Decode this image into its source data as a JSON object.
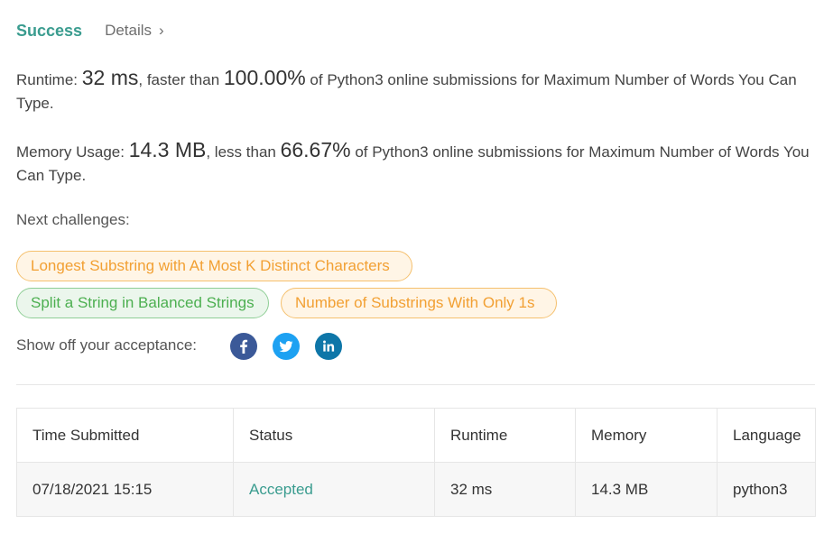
{
  "header": {
    "status": "Success",
    "details_label": "Details"
  },
  "runtime": {
    "label": "Runtime: ",
    "value": "32 ms",
    "middle": ", faster than ",
    "percent": "100.00%",
    "suffix": " of Python3 online submissions for Maximum Number of Words You Can Type."
  },
  "memory": {
    "label": "Memory Usage: ",
    "value": "14.3 MB",
    "middle": ", less than ",
    "percent": "66.67%",
    "suffix": " of Python3 online submissions for Maximum Number of Words You Can Type."
  },
  "next": {
    "label": "Next challenges:",
    "challenges": [
      {
        "title": "Longest Substring with At Most K Distinct Characters",
        "difficulty": "medium"
      },
      {
        "title": "Split a String in Balanced Strings",
        "difficulty": "easy"
      },
      {
        "title": "Number of Substrings With Only 1s",
        "difficulty": "medium"
      }
    ]
  },
  "share": {
    "label": "Show off your acceptance:",
    "icons": [
      "facebook-icon",
      "twitter-icon",
      "linkedin-icon"
    ],
    "colors": {
      "facebook": "#3b5998",
      "twitter": "#1da1f2",
      "linkedin": "#0e76a8"
    }
  },
  "table": {
    "headers": [
      "Time Submitted",
      "Status",
      "Runtime",
      "Memory",
      "Language"
    ],
    "rows": [
      {
        "time": "07/18/2021 15:15",
        "status": "Accepted",
        "runtime": "32 ms",
        "memory": "14.3 MB",
        "language": "python3"
      }
    ]
  },
  "colors": {
    "accent": "#3a9c8f",
    "medium": "#f2a033",
    "easy": "#4caf50"
  }
}
